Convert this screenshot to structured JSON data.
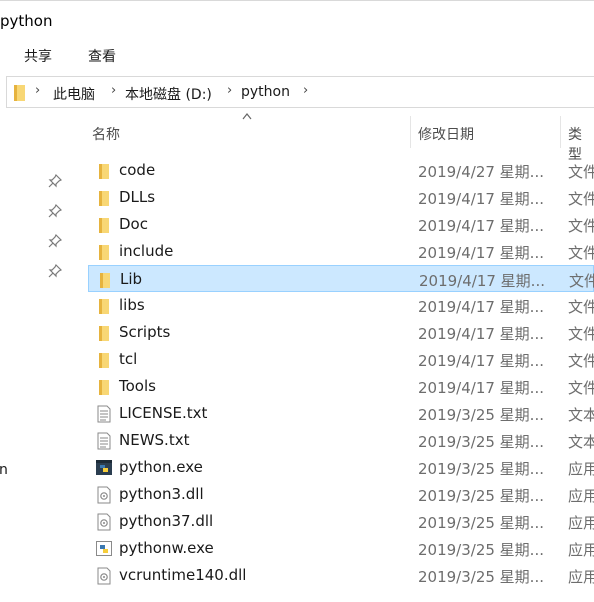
{
  "window": {
    "title": "python"
  },
  "ribbon": {
    "tabs": [
      "共享",
      "查看"
    ]
  },
  "address": {
    "crumbs": [
      "此电脑",
      "本地磁盘 (D:)",
      "python"
    ]
  },
  "nav": {
    "fragment": "n"
  },
  "columns": {
    "name": "名称",
    "date": "修改日期",
    "type": "类型"
  },
  "files": [
    {
      "name": "code",
      "date": "2019/4/27 星期...",
      "type": "文件",
      "icon": "folder-icon",
      "selected": false
    },
    {
      "name": "DLLs",
      "date": "2019/4/17 星期...",
      "type": "文件",
      "icon": "folder-icon",
      "selected": false
    },
    {
      "name": "Doc",
      "date": "2019/4/17 星期...",
      "type": "文件",
      "icon": "folder-icon",
      "selected": false
    },
    {
      "name": "include",
      "date": "2019/4/17 星期...",
      "type": "文件",
      "icon": "folder-icon",
      "selected": false
    },
    {
      "name": "Lib",
      "date": "2019/4/17 星期...",
      "type": "文件",
      "icon": "folder-icon",
      "selected": true
    },
    {
      "name": "libs",
      "date": "2019/4/17 星期...",
      "type": "文件",
      "icon": "folder-icon",
      "selected": false
    },
    {
      "name": "Scripts",
      "date": "2019/4/17 星期...",
      "type": "文件",
      "icon": "folder-icon",
      "selected": false
    },
    {
      "name": "tcl",
      "date": "2019/4/17 星期...",
      "type": "文件",
      "icon": "folder-icon",
      "selected": false
    },
    {
      "name": "Tools",
      "date": "2019/4/17 星期...",
      "type": "文件",
      "icon": "folder-icon",
      "selected": false
    },
    {
      "name": "LICENSE.txt",
      "date": "2019/3/25 星期...",
      "type": "文本",
      "icon": "text-file-icon",
      "selected": false
    },
    {
      "name": "NEWS.txt",
      "date": "2019/3/25 星期...",
      "type": "文本",
      "icon": "text-file-icon",
      "selected": false
    },
    {
      "name": "python.exe",
      "date": "2019/3/25 星期...",
      "type": "应用",
      "icon": "python-exe-icon",
      "selected": false
    },
    {
      "name": "python3.dll",
      "date": "2019/3/25 星期...",
      "type": "应用",
      "icon": "dll-file-icon",
      "selected": false
    },
    {
      "name": "python37.dll",
      "date": "2019/3/25 星期...",
      "type": "应用",
      "icon": "dll-file-icon",
      "selected": false
    },
    {
      "name": "pythonw.exe",
      "date": "2019/3/25 星期...",
      "type": "应用",
      "icon": "pythonw-exe-icon",
      "selected": false
    },
    {
      "name": "vcruntime140.dll",
      "date": "2019/3/25 星期...",
      "type": "应用",
      "icon": "dll-file-icon",
      "selected": false
    }
  ],
  "colors": {
    "folder": "#f8d775",
    "folder_dark": "#e6b33e",
    "selection_bg": "#cce8ff",
    "selection_border": "#99d1ff"
  }
}
